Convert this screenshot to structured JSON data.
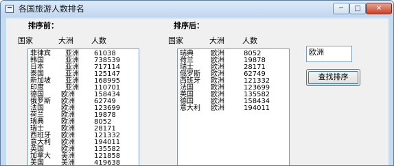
{
  "window": {
    "title": "各国旅游人数排名",
    "min_glyph": "─",
    "max_glyph": "□",
    "close_glyph": "✕"
  },
  "before": {
    "heading": "排序前：",
    "col_country": "国家",
    "col_continent": "大洲",
    "col_count": "人数",
    "rows": [
      [
        "菲律宾",
        "亚洲",
        "61038"
      ],
      [
        "韩国",
        "亚洲",
        "738539"
      ],
      [
        "日本",
        "亚洲",
        "717114"
      ],
      [
        "泰国",
        "亚洲",
        "125147"
      ],
      [
        "新加坡",
        "亚洲",
        "168995"
      ],
      [
        "印度",
        "亚洲",
        "110701"
      ],
      [
        "德国",
        "欧洲",
        "158434"
      ],
      [
        "俄罗斯",
        "欧洲",
        "62749"
      ],
      [
        "法国",
        "欧洲",
        "123699"
      ],
      [
        "荷兰",
        "欧洲",
        "19878"
      ],
      [
        "瑞典",
        "欧洲",
        "8052"
      ],
      [
        "瑞士",
        "欧洲",
        "28171"
      ],
      [
        "西班牙",
        "欧洲",
        "121332"
      ],
      [
        "意大利",
        "欧洲",
        "194011"
      ],
      [
        "英国",
        "欧洲",
        "135582"
      ],
      [
        "加拿大",
        "美洲",
        "121858"
      ],
      [
        "美国",
        "美洲",
        "419638"
      ]
    ]
  },
  "after": {
    "heading": "排序后：",
    "col_country": "国家",
    "col_continent": "大洲",
    "col_count": "人数",
    "rows": [
      [
        "瑞典",
        "欧洲",
        "8052"
      ],
      [
        "荷兰",
        "欧洲",
        "19878"
      ],
      [
        "瑞士",
        "欧洲",
        "28171"
      ],
      [
        "俄罗斯",
        "欧洲",
        "62749"
      ],
      [
        "西班牙",
        "欧洲",
        "121332"
      ],
      [
        "法国",
        "欧洲",
        "123699"
      ],
      [
        "英国",
        "欧洲",
        "135582"
      ],
      [
        "德国",
        "欧洲",
        "158434"
      ],
      [
        "意大利",
        "欧洲",
        "194011"
      ]
    ]
  },
  "search": {
    "value": "欧洲",
    "button_label": "查找排序"
  }
}
